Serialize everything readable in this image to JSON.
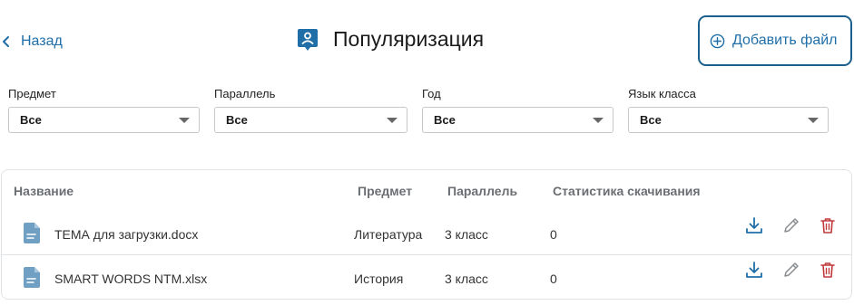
{
  "header": {
    "back_label": "Назад",
    "title": "Популяризация",
    "add_file_label": "Добавить файл"
  },
  "filters": [
    {
      "label": "Предмет",
      "value": "Все"
    },
    {
      "label": "Параллель",
      "value": "Все"
    },
    {
      "label": "Год",
      "value": "Все"
    },
    {
      "label": "Язык класса",
      "value": "Все"
    }
  ],
  "table": {
    "columns": [
      "Название",
      "Предмет",
      "Параллель",
      "Статистика скачивания"
    ],
    "rows": [
      {
        "name": "ТЕМА для загрузки.docx",
        "subject": "Литература",
        "parallel": "3 класс",
        "downloads": "0"
      },
      {
        "name": "SMART WORDS NTM.xlsx",
        "subject": "История",
        "parallel": "3 класс",
        "downloads": "0"
      }
    ]
  },
  "icons": {
    "back": "chevron-left-icon",
    "title": "user-badge-icon",
    "add": "plus-circle-icon",
    "file": "document-icon",
    "download": "download-icon",
    "edit": "pencil-icon",
    "delete": "trash-icon"
  },
  "colors": {
    "accent": "#1f6ea8",
    "button_border": "#1b5f8c",
    "icon_file": "#6fa0c3",
    "delete": "#c0393b"
  }
}
